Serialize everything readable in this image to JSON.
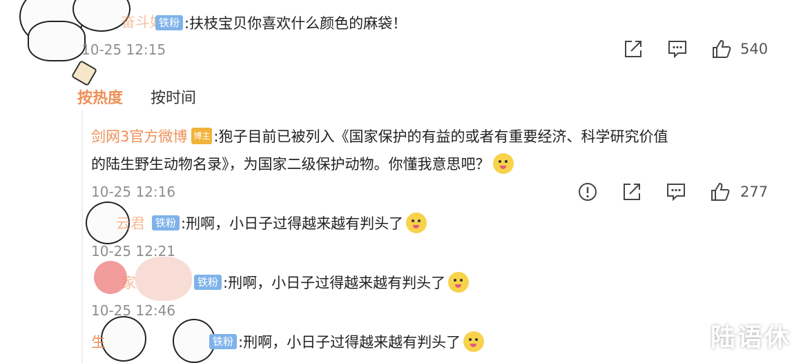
{
  "top_comment": {
    "user": "奋斗好",
    "badge": "铁粉",
    "text": ":扶枝宝贝你喜欢什么颜色的麻袋！",
    "time": "10-25 12:15",
    "likes": "540"
  },
  "sort_tabs": {
    "hot": "按热度",
    "time": "按时间"
  },
  "main_reply": {
    "user": "剑网3官方微博",
    "badge": "博主",
    "line1": ":狍子目前已被列入《国家保护的有益的或者有重要经济、科学研究价值",
    "line2": "的陆生野生动物名录》，为国家二级保护动物。你懂我意思吧？",
    "time": "10-25 12:16",
    "likes": "277"
  },
  "sub_replies": [
    {
      "user": "云君",
      "badge": "铁粉",
      "text": ":刑啊，小日子过得越来越有判头了",
      "time": "10-25 12:21"
    },
    {
      "user": "家",
      "badge": "铁粉",
      "text": ":刑啊，小日子过得越来越有判头了",
      "time": "10-25 12:46"
    },
    {
      "user": "生",
      "badge": "铁粉",
      "text": ":刑啊，小日子过得越来越有判头了"
    }
  ],
  "watermark": "陆语休",
  "colors": {
    "username": "#ee8f57",
    "badge": "#7fb2ea",
    "badge_gold": "#f1b33a",
    "time": "#8e8e8e"
  }
}
